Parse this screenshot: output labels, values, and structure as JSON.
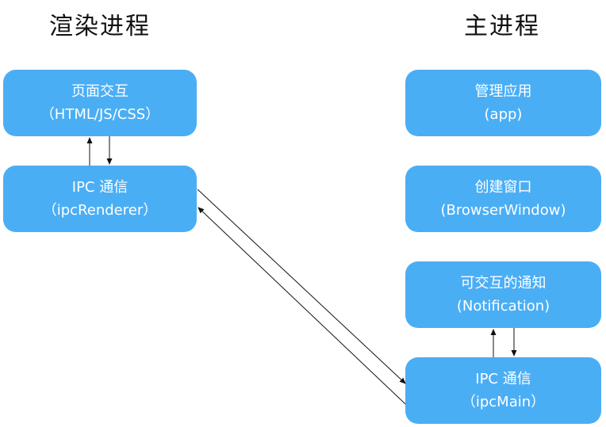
{
  "left_column": {
    "title": "渲染进程",
    "boxes": [
      {
        "line1": "页面交互",
        "line2": "（HTML/JS/CSS）"
      },
      {
        "line1": "IPC 通信",
        "line2": "（ipcRenderer）"
      }
    ]
  },
  "right_column": {
    "title": "主进程",
    "boxes": [
      {
        "line1": "管理应用",
        "line2": "(app)"
      },
      {
        "line1": "创建窗口",
        "line2": "(BrowserWindow)"
      },
      {
        "line1": "可交互的通知",
        "line2": "(Notification)"
      },
      {
        "line1": "IPC 通信",
        "line2": "（ipcMain）"
      }
    ]
  },
  "colors": {
    "box": "#4aaef5",
    "text": "#ffffff",
    "arrow": "#111111"
  }
}
